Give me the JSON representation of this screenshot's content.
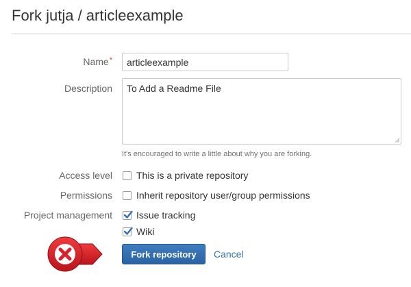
{
  "header": {
    "title": "Fork jutja / articleexample"
  },
  "form": {
    "name_label": "Name",
    "required_mark": "*",
    "name_value": "articleexample",
    "description_label": "Description",
    "description_value": "To Add a Readme File",
    "description_help": "It's encouraged to write a little about why you are forking.",
    "access_level_label": "Access level",
    "private_repo_label": "This is a private repository",
    "private_repo_checked": false,
    "permissions_label": "Permissions",
    "inherit_permissions_label": "Inherit repository user/group permissions",
    "inherit_permissions_checked": false,
    "project_management_label": "Project management",
    "issue_tracking_label": "Issue tracking",
    "issue_tracking_checked": true,
    "wiki_label": "Wiki",
    "wiki_checked": true
  },
  "actions": {
    "fork_button_label": "Fork repository",
    "cancel_label": "Cancel"
  },
  "overlay": {
    "icon": "x-mark-badge-icon",
    "color": "#d9222a"
  },
  "colors": {
    "primary_button": "#3572b0",
    "link": "#3572b0",
    "required": "#d04437"
  }
}
